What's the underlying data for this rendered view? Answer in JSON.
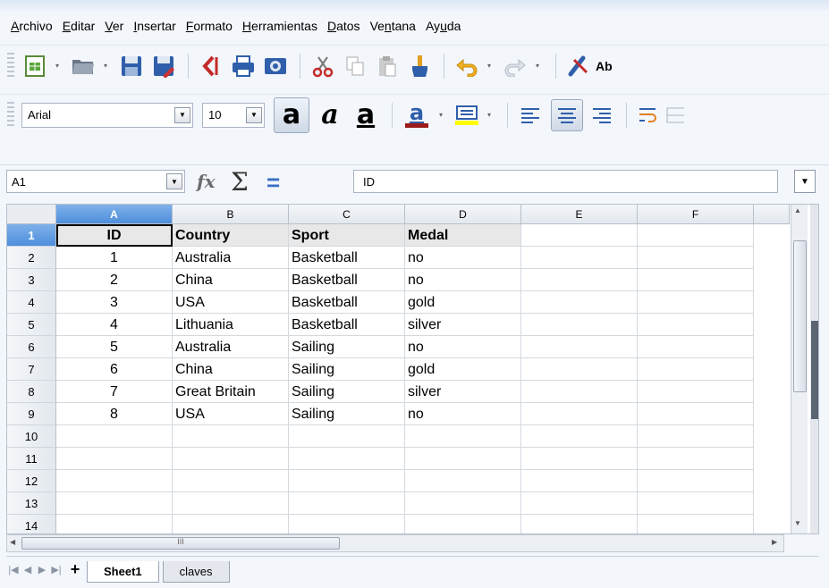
{
  "menubar": {
    "items": [
      {
        "pre": "",
        "u": "A",
        "post": "rchivo"
      },
      {
        "pre": "",
        "u": "E",
        "post": "ditar"
      },
      {
        "pre": "",
        "u": "V",
        "post": "er"
      },
      {
        "pre": "",
        "u": "I",
        "post": "nsertar"
      },
      {
        "pre": "",
        "u": "F",
        "post": "ormato"
      },
      {
        "pre": "",
        "u": "H",
        "post": "erramientas"
      },
      {
        "pre": "",
        "u": "D",
        "post": "atos"
      },
      {
        "pre": "Ve",
        "u": "n",
        "post": "tana"
      },
      {
        "pre": "Ay",
        "u": "u",
        "post": "da"
      }
    ]
  },
  "formatting": {
    "font_name": "Arial",
    "font_size": "10",
    "bold_glyph": "a",
    "italic_glyph": "a",
    "underline_glyph": "a",
    "fontcolor_glyph": "a",
    "spellcheck_label": "Ab"
  },
  "formula_bar": {
    "cell_ref": "A1",
    "content": "ID"
  },
  "sheet": {
    "columns": [
      "A",
      "B",
      "C",
      "D",
      "E",
      "F"
    ],
    "row_labels": [
      "1",
      "2",
      "3",
      "4",
      "5",
      "6",
      "7",
      "8",
      "9",
      "10",
      "11",
      "12",
      "13",
      "14"
    ],
    "header": [
      "ID",
      "Country",
      "Sport",
      "Medal"
    ],
    "rows": [
      [
        "1",
        "Australia",
        "Basketball",
        "no"
      ],
      [
        "2",
        "China",
        "Basketball",
        "no"
      ],
      [
        "3",
        "USA",
        "Basketball",
        "gold"
      ],
      [
        "4",
        "Lithuania",
        "Basketball",
        "silver"
      ],
      [
        "5",
        "Australia",
        "Sailing",
        "no"
      ],
      [
        "6",
        "China",
        "Sailing",
        "gold"
      ],
      [
        "7",
        "Great Britain",
        "Sailing",
        "silver"
      ],
      [
        "8",
        "USA",
        "Sailing",
        "no"
      ]
    ]
  },
  "tabs": {
    "items": [
      "Sheet1",
      "claves"
    ],
    "active": "Sheet1",
    "add_symbol": "+"
  },
  "hscroll": {
    "grip": "III"
  },
  "colors": {
    "selected_header": "#4e8edb",
    "header_row_fill": "#e8e8e8",
    "fontcolor_bar": "#9b1b1b",
    "highlight_bar": "#ffff00"
  }
}
